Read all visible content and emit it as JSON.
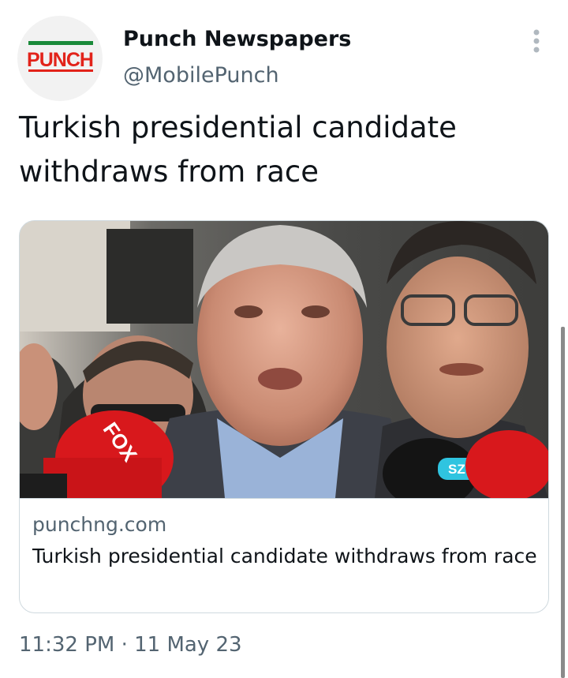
{
  "tweet": {
    "author": {
      "display_name": "Punch Newspapers",
      "handle": "@MobilePunch",
      "avatar_logo_text": "PUNCH",
      "avatar_icon": "punch-logo-icon"
    },
    "more_icon": "more-vertical-icon",
    "text": "Turkish presidential candidate withdraws from race",
    "card": {
      "image_alt": "Turkish presidential candidate speaking to press microphones",
      "mic_labels": [
        "FOX",
        "SZC"
      ],
      "domain": "punchng.com",
      "title": "Turkish presidential candidate withdraws from race"
    },
    "timestamp": "11:32 PM · 11 May 23"
  },
  "colors": {
    "text_primary": "#0f1419",
    "text_secondary": "#536471",
    "border": "#cfd9de",
    "brand_red": "#e2231a",
    "brand_green": "#1a8a3a"
  }
}
